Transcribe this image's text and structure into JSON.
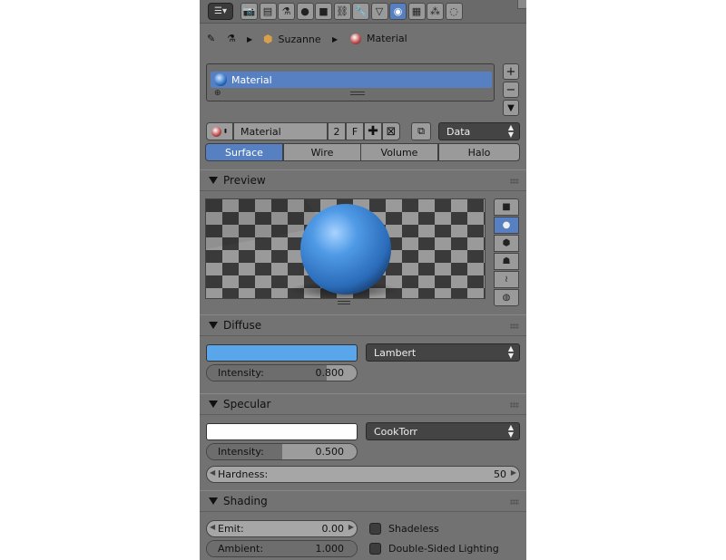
{
  "header": {
    "context_tabs": [
      {
        "name": "render-icon",
        "glyph": "📷",
        "active": false
      },
      {
        "name": "render-layers-icon",
        "glyph": "▤",
        "active": false
      },
      {
        "name": "scene-icon",
        "glyph": "⚗",
        "active": false
      },
      {
        "name": "world-icon",
        "glyph": "●",
        "active": false
      },
      {
        "name": "object-icon",
        "glyph": "■",
        "active": false
      },
      {
        "name": "constraints-icon",
        "glyph": "⛓",
        "active": false
      },
      {
        "name": "modifiers-icon",
        "glyph": "🔧",
        "active": false
      },
      {
        "name": "object-data-icon",
        "glyph": "▽",
        "active": false
      },
      {
        "name": "material-icon",
        "glyph": "◉",
        "active": true
      },
      {
        "name": "texture-icon",
        "glyph": "▦",
        "active": false
      },
      {
        "name": "particles-icon",
        "glyph": "⁂",
        "active": false
      },
      {
        "name": "physics-icon",
        "glyph": "◌",
        "active": false
      }
    ]
  },
  "breadcrumb": {
    "object": "Suzanne",
    "material": "Material"
  },
  "material_slots": {
    "items": [
      "Material"
    ]
  },
  "datablock": {
    "name": "Material",
    "users": "2",
    "fake_user": "F",
    "link": "Data"
  },
  "type_tabs": [
    {
      "label": "Surface",
      "active": true
    },
    {
      "label": "Wire",
      "active": false
    },
    {
      "label": "Volume",
      "active": false
    },
    {
      "label": "Halo",
      "active": false
    }
  ],
  "preview": {
    "title": "Preview"
  },
  "diffuse": {
    "title": "Diffuse",
    "color": "#5aa6ea",
    "shader": "Lambert",
    "intensity_label": "Intensity:",
    "intensity": "0.800",
    "intensity_fraction": 0.8
  },
  "specular": {
    "title": "Specular",
    "color": "#ffffff",
    "shader": "CookTorr",
    "intensity_label": "Intensity:",
    "intensity": "0.500",
    "intensity_fraction": 0.5,
    "hardness_label": "Hardness:",
    "hardness": "50"
  },
  "shading": {
    "title": "Shading",
    "emit_label": "Emit:",
    "emit": "0.00",
    "ambient_label": "Ambient:",
    "ambient": "1.000",
    "ambient_fraction": 1.0,
    "shadeless": "Shadeless",
    "double_sided": "Double-Sided Lighting"
  },
  "colors": {
    "panel": "#727272",
    "accent": "#5680c2"
  }
}
